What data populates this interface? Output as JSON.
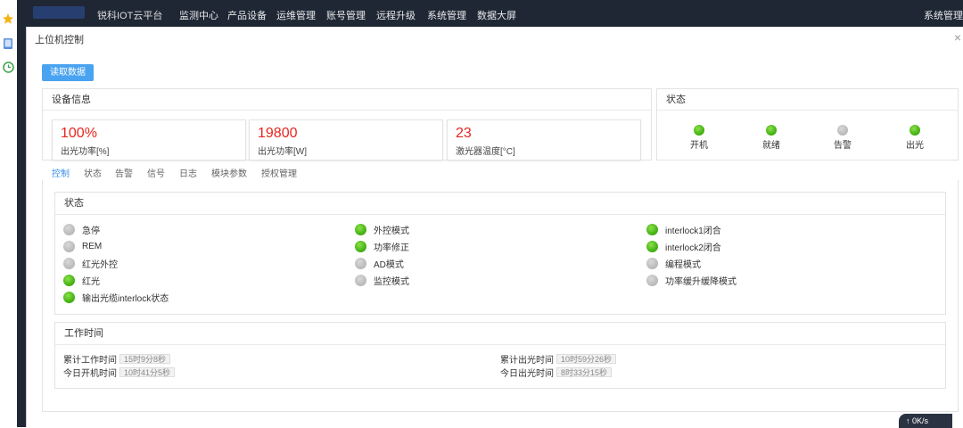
{
  "topbar": {
    "brand": "锐科IOT云平台",
    "nav": [
      "监测中心",
      "产品设备",
      "运维管理",
      "账号管理",
      "远程升级",
      "系统管理",
      "数据大屏"
    ],
    "right": "系统管理"
  },
  "dialog": {
    "title": "上位机控制",
    "close": "×",
    "read_button": "读取数据"
  },
  "device_info": {
    "title": "设备信息",
    "cards": [
      {
        "value": "100%",
        "label": "出光功率[%]"
      },
      {
        "value": "19800",
        "label": "出光功率[W]"
      },
      {
        "value": "23",
        "label": "激光器温度[°C]"
      }
    ]
  },
  "status_panel": {
    "title": "状态",
    "items": [
      {
        "label": "开机",
        "on": true
      },
      {
        "label": "就绪",
        "on": true
      },
      {
        "label": "告警",
        "on": false
      },
      {
        "label": "出光",
        "on": true
      }
    ]
  },
  "tabs": [
    "控制",
    "状态",
    "告警",
    "信号",
    "日志",
    "模块参数",
    "授权管理"
  ],
  "control": {
    "status_title": "状态",
    "col1": [
      {
        "label": "急停",
        "on": false
      },
      {
        "label": "REM",
        "on": false
      },
      {
        "label": "红光外控",
        "on": false
      },
      {
        "label": "红光",
        "on": true
      },
      {
        "label": "输出光缆interlock状态",
        "on": true
      }
    ],
    "col2": [
      {
        "label": "外控模式",
        "on": true
      },
      {
        "label": "功率修正",
        "on": true
      },
      {
        "label": "AD模式",
        "on": false
      },
      {
        "label": "监控模式",
        "on": false
      }
    ],
    "col3": [
      {
        "label": "interlock1闭合",
        "on": true
      },
      {
        "label": "interlock2闭合",
        "on": true
      },
      {
        "label": "编程模式",
        "on": false
      },
      {
        "label": "功率缓升缓降模式",
        "on": false
      }
    ],
    "worktime_title": "工作时间",
    "worktime": {
      "total_work_label": "累计工作时间",
      "total_work": "15时9分8秒",
      "today_on_label": "今日开机时间",
      "today_on": "10时41分5秒",
      "total_light_label": "累计出光时间",
      "total_light": "10时59分26秒",
      "today_light_label": "今日出光时间",
      "today_light": "8时33分15秒"
    }
  },
  "net": {
    "speed": "0K/s"
  }
}
